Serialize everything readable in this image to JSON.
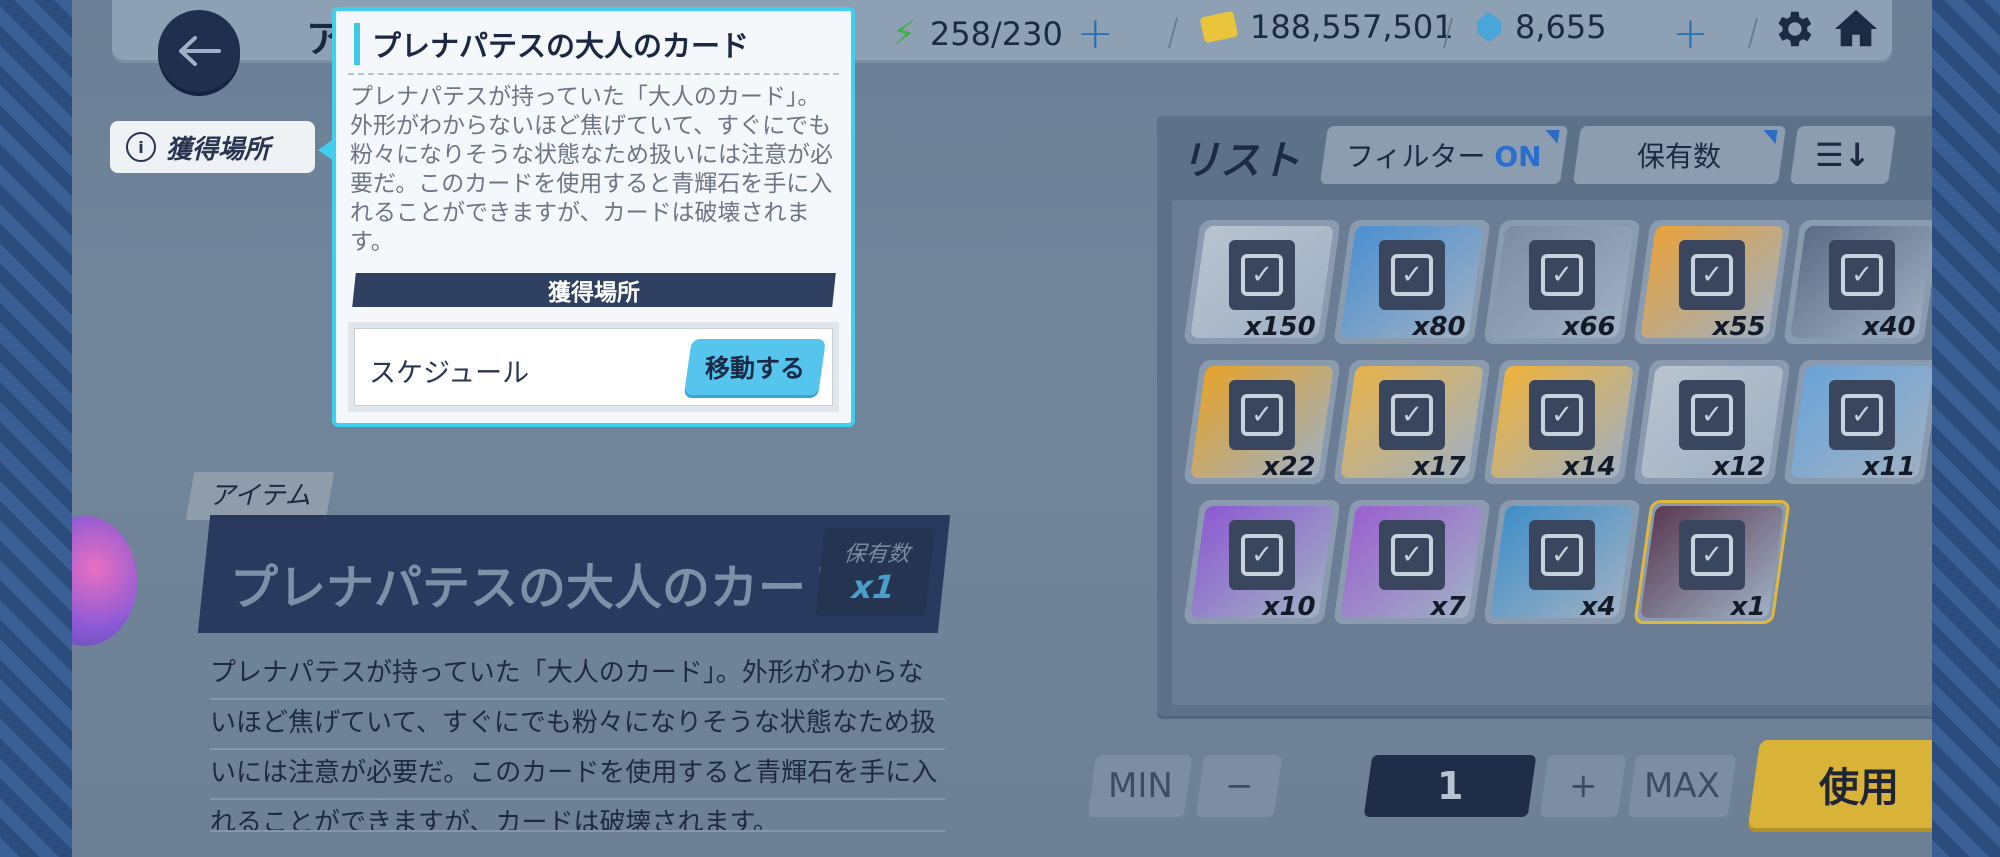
{
  "topbar": {
    "title_partial": "アイ",
    "ap": "258/230",
    "credits": "188,557,501",
    "gems": "8,655"
  },
  "acquisition_tag": {
    "label": "獲得場所"
  },
  "item": {
    "category": "アイテム",
    "name": "プレナパテスの大人のカード",
    "owned_label": "保有数",
    "owned_value": "x1",
    "description_lines": [
      "プレナパテスが持っていた「大人のカード」。外形がわからな",
      "いほど焦げていて、すぐにでも粉々になりそうな状態なため扱",
      "いには注意が必要だ。このカードを使用すると青輝石を手に入",
      "れることができますが、カードは破壊されます。"
    ]
  },
  "list": {
    "title": "リスト",
    "filter_label": "フィルター",
    "filter_state": "ON",
    "sort_label": "保有数",
    "sort_order_icon": "sort-descending-icon",
    "items": [
      {
        "count": "x150",
        "color": "#b8c3cf"
      },
      {
        "count": "x80",
        "color": "#4b8fd0"
      },
      {
        "count": "x66",
        "color": "#7d8ea4"
      },
      {
        "count": "x55",
        "color": "#e9a23a"
      },
      {
        "count": "x40",
        "color": "#5c6c86"
      },
      {
        "count": "x22",
        "color": "#e6a32a"
      },
      {
        "count": "x17",
        "color": "#e8b34a"
      },
      {
        "count": "x14",
        "color": "#efb23a"
      },
      {
        "count": "x12",
        "color": "#b9c3cf"
      },
      {
        "count": "x11",
        "color": "#6aa4d8"
      },
      {
        "count": "x10",
        "color": "#8d5ad2"
      },
      {
        "count": "x7",
        "color": "#9b5fd0"
      },
      {
        "count": "x4",
        "color": "#3f8fc8"
      },
      {
        "count": "x1",
        "color": "#5a3a52"
      }
    ]
  },
  "controls": {
    "min": "MIN",
    "minus": "−",
    "quantity": "1",
    "plus": "+",
    "max": "MAX",
    "use": "使用"
  },
  "popup": {
    "title": "プレナパテスの大人のカード",
    "description": "プレナパテスが持っていた「大人のカード」。外形がわからないほど焦げていて、すぐにでも粉々になりそうな状態なため扱いには注意が必要だ。このカードを使用すると青輝石を手に入れることができますが、カードは破壊されます。",
    "section_header": "獲得場所",
    "source_label": "スケジュール",
    "move_button": "移動する"
  }
}
